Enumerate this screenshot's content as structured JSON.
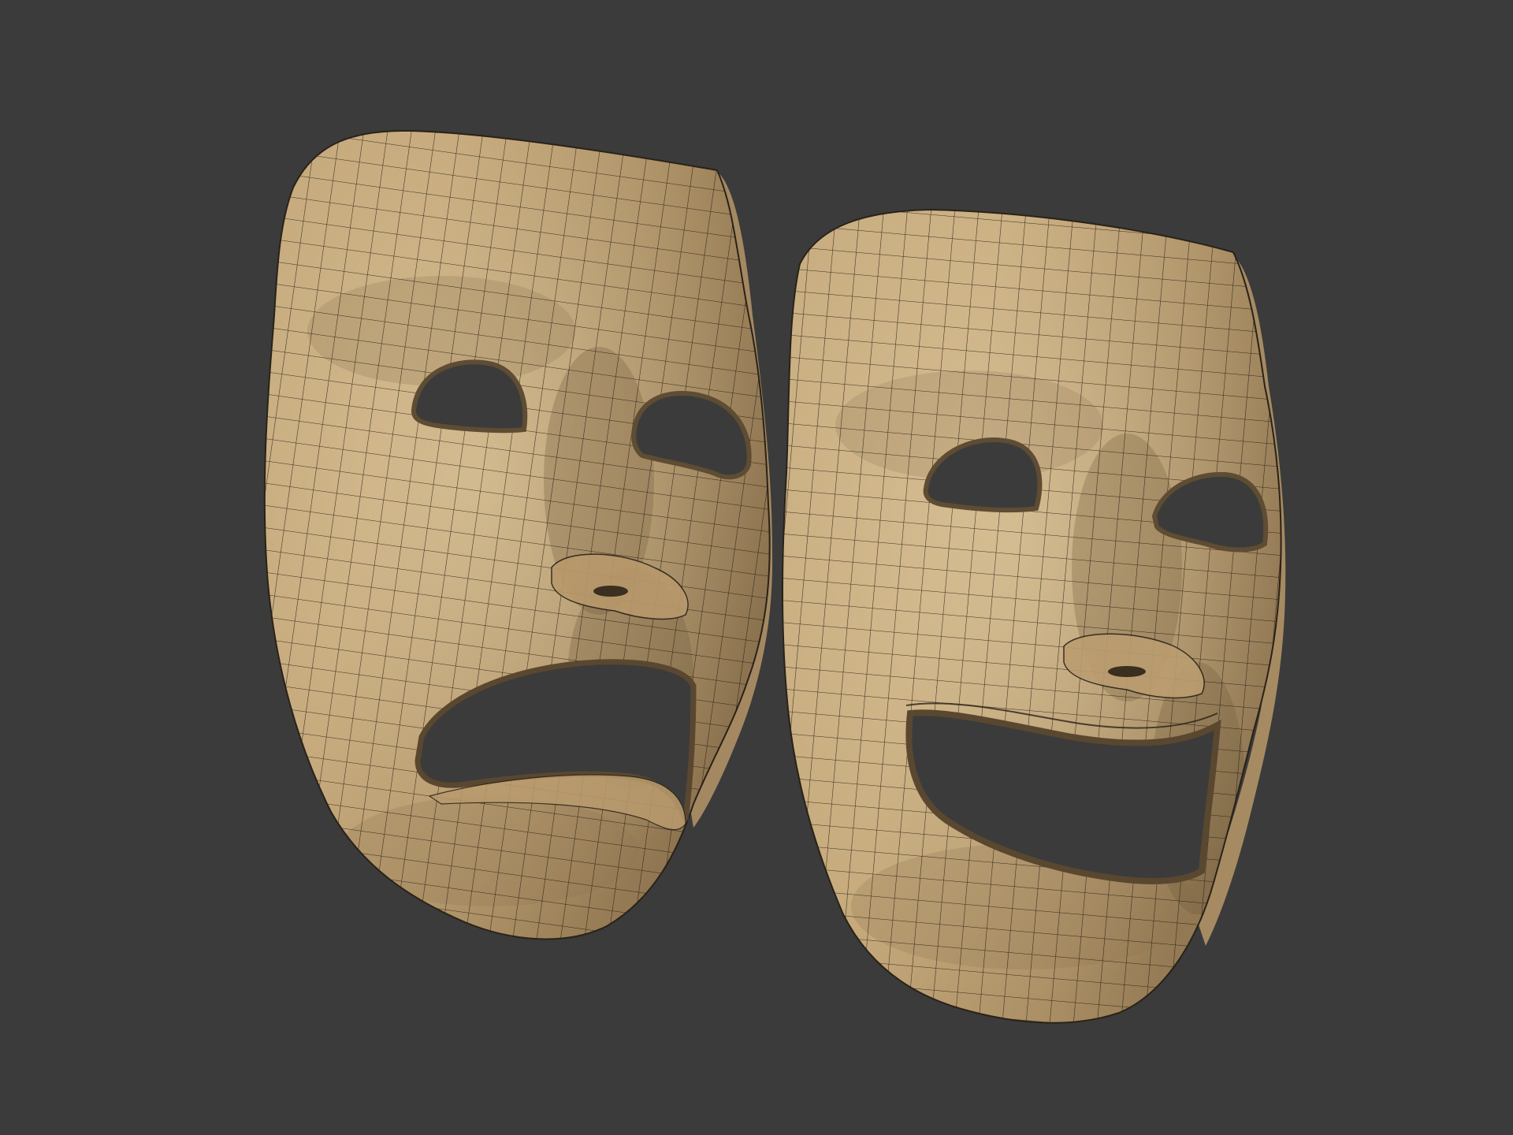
{
  "viewport": {
    "background": "#3b3b3b"
  },
  "material": {
    "base": "#c9ad82",
    "light": "#dcc49a",
    "shadow": "#7d6746",
    "deep": "#4e3f2a",
    "wire": "#1e1810"
  },
  "objects": [
    {
      "name": "tragedy-mask",
      "expression": "sad"
    },
    {
      "name": "comedy-mask",
      "expression": "happy"
    }
  ]
}
